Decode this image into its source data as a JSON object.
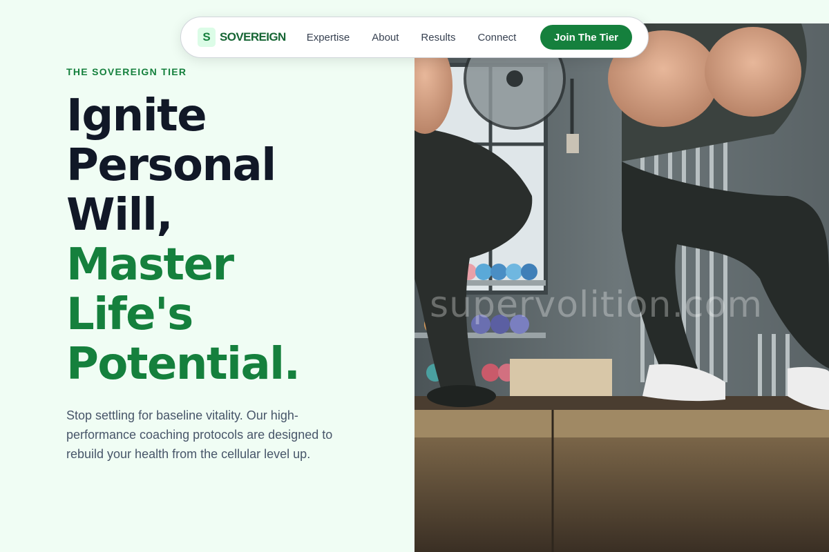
{
  "nav": {
    "logo_letter": "S",
    "brand": "SOVEREIGN",
    "links": [
      "Expertise",
      "About",
      "Results",
      "Connect"
    ],
    "cta": "Join The Tier"
  },
  "hero": {
    "eyebrow": "THE SOVEREIGN TIER",
    "headline_dark": [
      "Ignite",
      "Personal",
      "Will,"
    ],
    "headline_green": [
      "Master",
      "Life's",
      "Potential."
    ],
    "subtext": "Stop settling for baseline vitality. Our high-performance coaching protocols are designed to rebuild your health from the cellular level up."
  },
  "image": {
    "description_icon": "gym-photo",
    "watermark": "supervolition.com"
  },
  "colors": {
    "page_bg": "#f0fdf4",
    "accent": "#15803d",
    "heading": "#111827",
    "body_text": "#475569"
  }
}
